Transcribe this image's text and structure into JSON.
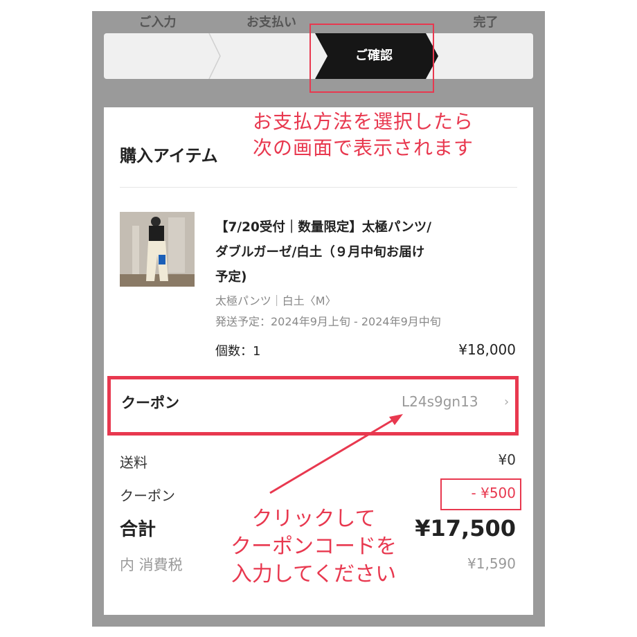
{
  "steps": [
    {
      "label": "ご入力",
      "active": false
    },
    {
      "label": "お支払い",
      "active": false
    },
    {
      "label": "ご確認",
      "active": true
    },
    {
      "label": "完了",
      "active": false
    }
  ],
  "annotations": {
    "top_note_line1": "お支払方法を選択したら",
    "top_note_line2": "次の画面で表示されます",
    "bottom_note_line1": "クリックして",
    "bottom_note_line2": "クーポンコードを",
    "bottom_note_line3": "入力してください"
  },
  "section_title": "購入アイテム",
  "item": {
    "name_line1": "【7/20受付｜数量限定】太極パンツ/",
    "name_line2": "ダブルガーゼ/白土（９月中旬お届け",
    "name_line3": "予定)",
    "variant": "太極パンツ｜白土〈M〉",
    "shipping": "発送予定：2024年9月上旬 - 2024年9月中旬",
    "quantity": "個数：1",
    "price": "¥18,000"
  },
  "coupon": {
    "label": "クーポン",
    "code": "L24s9gn13"
  },
  "summary": {
    "shipping_label": "送料",
    "shipping_value": "¥0",
    "coupon_label": "クーポン",
    "coupon_value": "- ¥500",
    "total_label": "合計",
    "total_value": "¥17,500",
    "tax_label": "内 消費税",
    "tax_value": "¥1,590"
  },
  "colors": {
    "accent_red": "#e8384f",
    "active_step": "#161616",
    "frame_gray": "#9a9a9a"
  }
}
